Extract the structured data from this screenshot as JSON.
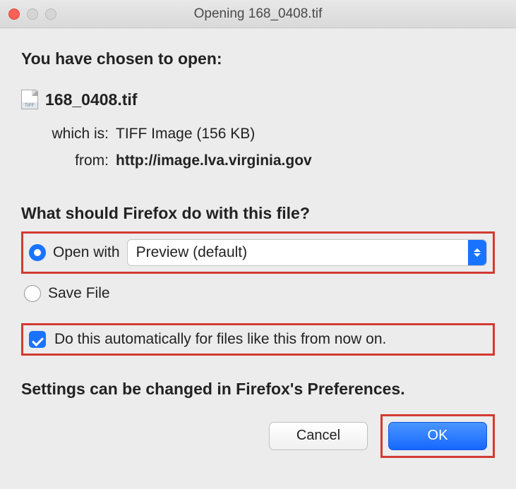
{
  "titlebar": {
    "title": "Opening 168_0408.tif"
  },
  "heading": "You have chosen to open:",
  "file": {
    "icon_badge": "TIFF",
    "name": "168_0408.tif",
    "which_is_label": "which is:",
    "which_is_value": "TIFF Image (156 KB)",
    "from_label": "from:",
    "from_value": "http://image.lva.virginia.gov"
  },
  "question": "What should Firefox do with this file?",
  "actions": {
    "open_with_label": "Open with",
    "app_selected": "Preview (default)",
    "save_file_label": "Save File",
    "auto_label": "Do this automatically for files like this from now on."
  },
  "settings_note": "Settings can be changed in Firefox's Preferences.",
  "buttons": {
    "cancel": "Cancel",
    "ok": "OK"
  }
}
